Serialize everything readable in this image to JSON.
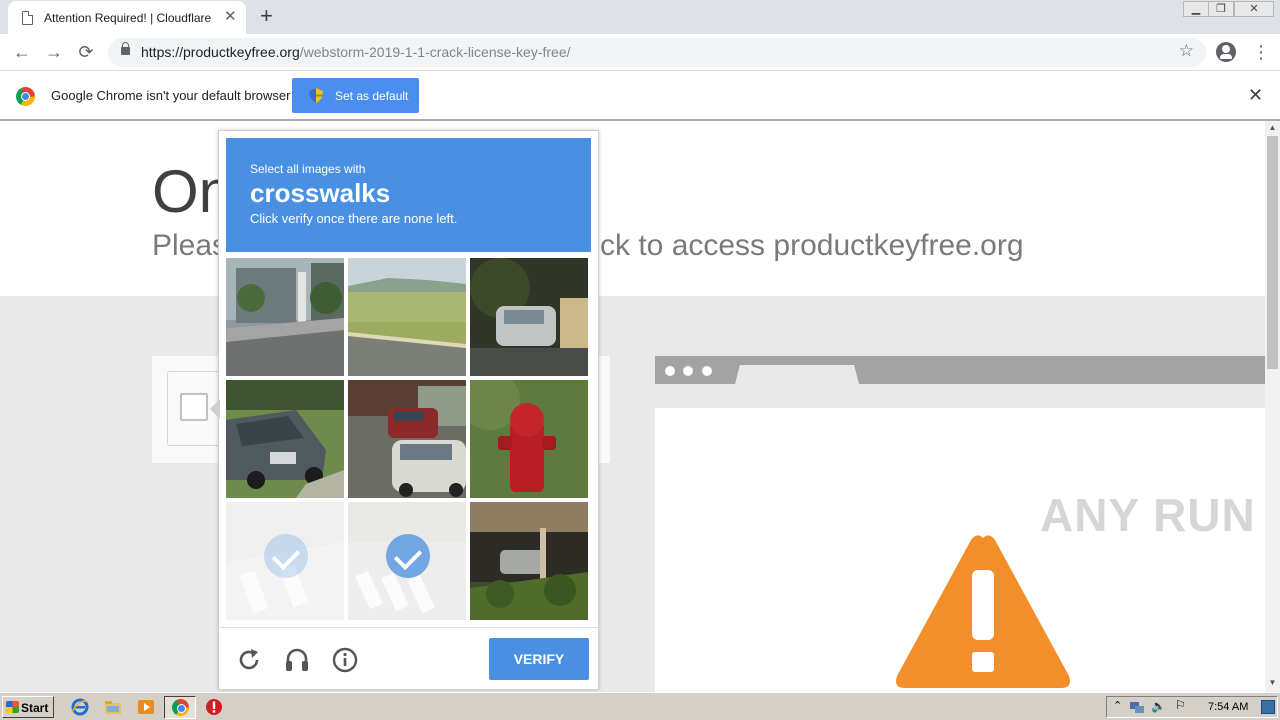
{
  "browser": {
    "tab_title": "Attention Required! | Cloudflare",
    "tab_close": "✕",
    "new_tab": "+",
    "window_controls": [
      "▭",
      "⧉",
      "✕"
    ],
    "url_host": "https://productkeyfree.org",
    "url_path": "/webstorm-2019-1-1-crack-license-key-free/",
    "bookmark_icon": "☆",
    "menu_icon": "⋮"
  },
  "infobar": {
    "message": "Google Chrome isn't your default browser",
    "button": "Set as default",
    "close": "✕"
  },
  "page": {
    "heading": "On",
    "subline_pre": "Pleas",
    "subline_post": "ck to access productkeyfree.org"
  },
  "captcha": {
    "instruction_top": "Select all images with",
    "target": "crosswalks",
    "instruction_bottom": "Click verify once there are none left.",
    "verify_button": "VERIFY",
    "tiles": [
      {
        "id": "tile-1",
        "selected": false
      },
      {
        "id": "tile-2",
        "selected": false
      },
      {
        "id": "tile-3",
        "selected": false
      },
      {
        "id": "tile-4",
        "selected": false
      },
      {
        "id": "tile-5",
        "selected": false
      },
      {
        "id": "tile-6",
        "selected": false
      },
      {
        "id": "tile-7",
        "selected": true
      },
      {
        "id": "tile-8",
        "selected": true
      },
      {
        "id": "tile-9",
        "selected": false
      }
    ],
    "accent_color": "#4a90e2"
  },
  "watermark": "ANY RUN",
  "taskbar": {
    "start": "Start",
    "clock": "7:54 AM"
  }
}
